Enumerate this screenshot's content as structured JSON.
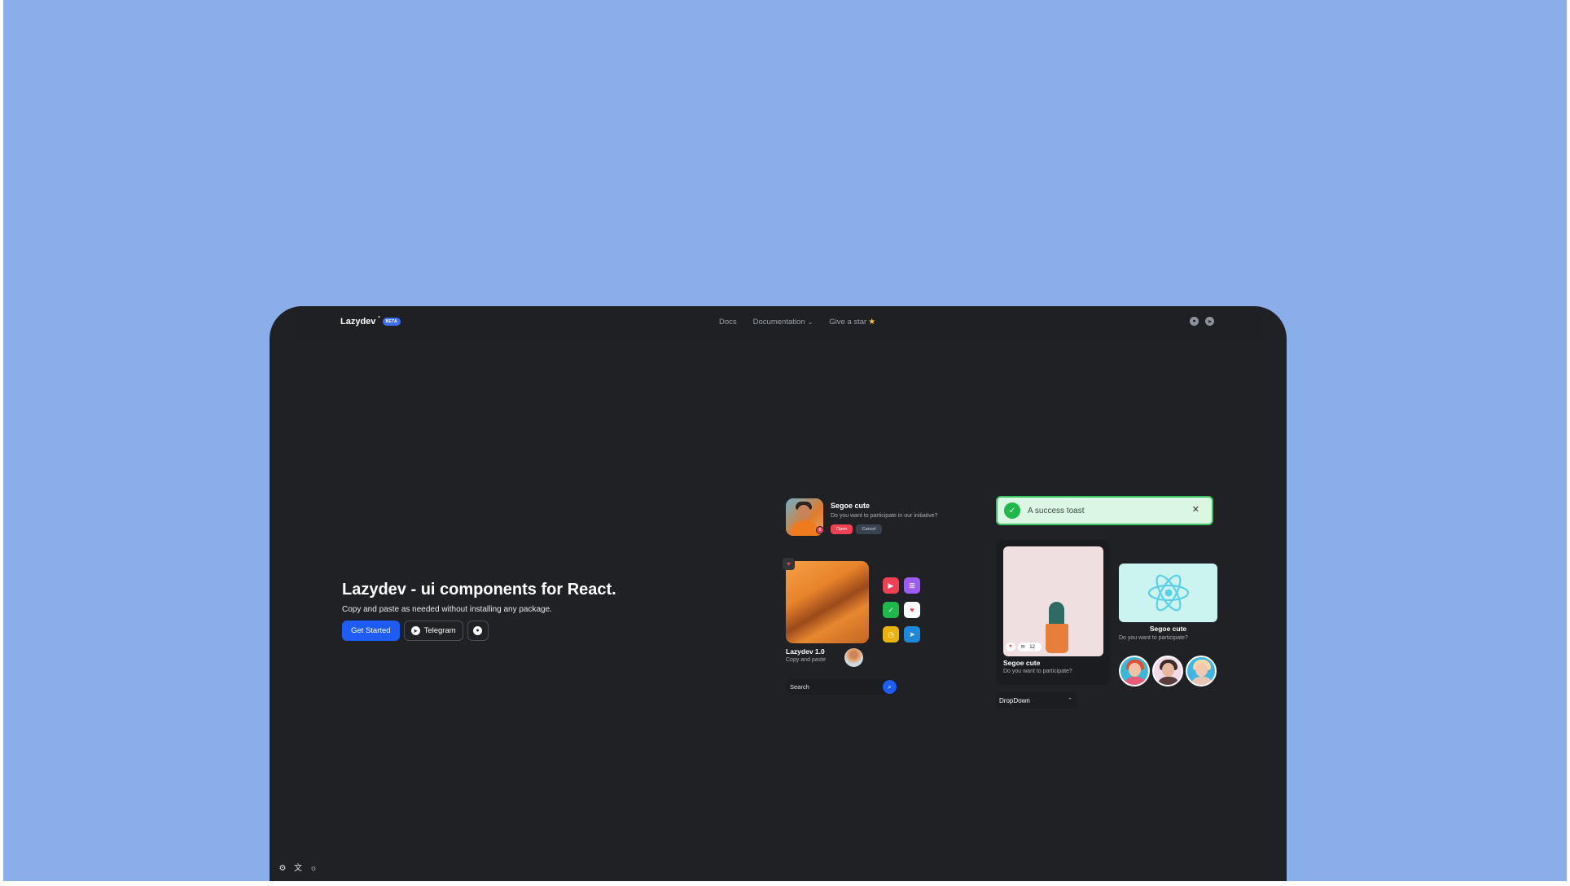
{
  "brand": {
    "name": "Lazydev",
    "badge": "BETA"
  },
  "nav": {
    "docs": "Docs",
    "documentation": "Documentation",
    "give_star": "Give a star"
  },
  "hero": {
    "title": "Lazydev - ui components for React.",
    "subtitle": "Copy and paste as needed without installing any package.",
    "get_started": "Get Started",
    "telegram": "Telegram"
  },
  "notification": {
    "title": "Segoe cute",
    "text": "Do you want to participate in our initiative?",
    "badge_count": "8",
    "open_label": "Open",
    "cancel_label": "Cancel"
  },
  "toast": {
    "message": "A success toast"
  },
  "product": {
    "title": "Lazydev 1.0",
    "subtitle": "Copy and paste"
  },
  "gallery": {
    "title": "Segoe cute",
    "subtitle": "Do you want to participate?",
    "comments": "12"
  },
  "react_card": {
    "title": "Segoe cute",
    "subtitle": "Do you want to participate?"
  },
  "search": {
    "label": "Search"
  },
  "dropdown": {
    "label": "DropDown"
  },
  "colors": {
    "background": "#8aaeea",
    "device": "#202124",
    "primary": "#1e5df5",
    "danger": "#ef4154",
    "success": "#1fb84a"
  },
  "icon_grid": [
    {
      "name": "play-icon",
      "color": "#ef4154"
    },
    {
      "name": "gift-icon",
      "color": "#9b5cf6"
    },
    {
      "name": "check-icon",
      "color": "#1fb84a"
    },
    {
      "name": "heart-icon",
      "color": "#ffffff"
    },
    {
      "name": "clock-icon",
      "color": "#eab308"
    },
    {
      "name": "telegram-icon",
      "color": "#1d88d8"
    }
  ]
}
